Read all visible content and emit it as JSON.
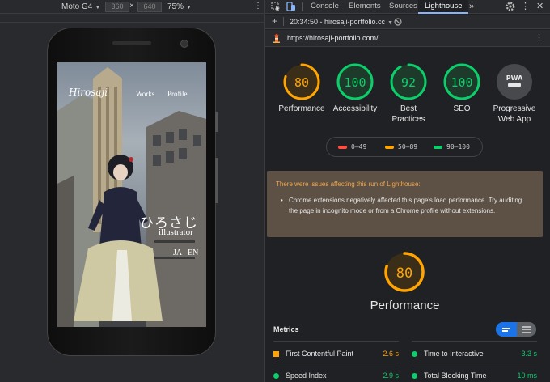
{
  "device_toolbar": {
    "device": "Moto G4",
    "width": "360",
    "height": "640",
    "times": "×",
    "zoom": "75%"
  },
  "site": {
    "logo": "Hirosaji",
    "nav": [
      "Works",
      "Profile"
    ],
    "title": "ひろさじ",
    "subtitle": "illustrator",
    "languages": [
      "JA",
      "EN"
    ]
  },
  "devtools": {
    "tabs": [
      "Console",
      "Elements",
      "Sources",
      "Lighthouse"
    ],
    "active_tab": "Lighthouse",
    "more_tabs": "»",
    "report_selector": "20:34:50 - hirosaji-portfolio.cc",
    "url": "https://hirosaji-portfolio.com/"
  },
  "lighthouse": {
    "gauges": [
      {
        "label_line1": "Performance",
        "label_line2": "",
        "score": "80",
        "value": 80,
        "status": "average"
      },
      {
        "label_line1": "Accessibility",
        "label_line2": "",
        "score": "100",
        "value": 100,
        "status": "pass"
      },
      {
        "label_line1": "Best",
        "label_line2": "Practices",
        "score": "92",
        "value": 92,
        "status": "pass"
      },
      {
        "label_line1": "SEO",
        "label_line2": "",
        "score": "100",
        "value": 100,
        "status": "pass"
      }
    ],
    "pwa": {
      "badge": "PWA",
      "label_line1": "Progressive",
      "label_line2": "Web App"
    },
    "legend": [
      {
        "range": "0–49",
        "color": "#ff4e42"
      },
      {
        "range": "50–89",
        "color": "#ffa400"
      },
      {
        "range": "90–100",
        "color": "#0cce6b"
      }
    ],
    "warning": {
      "title": "There were issues affecting this run of Lighthouse:",
      "items": [
        "Chrome extensions negatively affected this page's load performance. Try auditing the page in incognito mode or from a Chrome profile without extensions."
      ]
    },
    "category": {
      "title": "Performance",
      "score": "80",
      "value": 80
    },
    "metrics_title": "Metrics",
    "metrics": [
      {
        "name": "First Contentful Paint",
        "value": "2.6 s",
        "status": "average"
      },
      {
        "name": "Time to Interactive",
        "value": "3.3 s",
        "status": "pass"
      },
      {
        "name": "Speed Index",
        "value": "2.9 s",
        "status": "pass"
      },
      {
        "name": "Total Blocking Time",
        "value": "10 ms",
        "status": "pass"
      }
    ],
    "colors": {
      "pass": "#0cce6b",
      "average": "#ffa400",
      "fail": "#ff4e42",
      "pass_bg": "#1e3a2a",
      "average_bg": "#3b2e18"
    }
  }
}
